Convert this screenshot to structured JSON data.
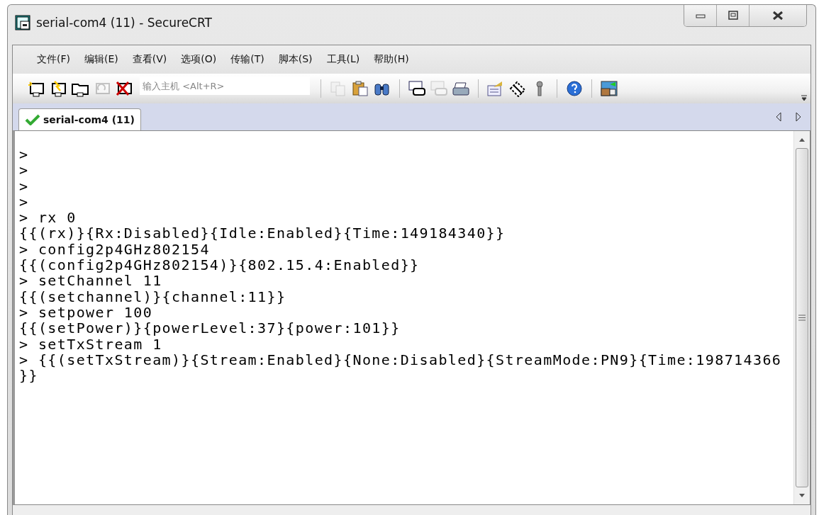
{
  "window": {
    "title": "serial-com4 (11) - SecureCRT"
  },
  "menu": [
    "文件(F)",
    "编辑(E)",
    "查看(V)",
    "选项(O)",
    "传输(T)",
    "脚本(S)",
    "工具(L)",
    "帮助(H)"
  ],
  "toolbar": [
    {
      "kind": "new-session",
      "disabled": false
    },
    {
      "kind": "quick-connect",
      "disabled": false
    },
    {
      "kind": "sessions",
      "disabled": false
    },
    {
      "kind": "reconnect",
      "disabled": true
    },
    {
      "kind": "disconnect",
      "disabled": false
    },
    {
      "kind": "host-field",
      "placeholder": "输入主机 <Alt+R>"
    },
    {
      "kind": "separator"
    },
    {
      "kind": "copy",
      "disabled": true
    },
    {
      "kind": "paste",
      "disabled": false
    },
    {
      "kind": "find",
      "disabled": false
    },
    {
      "kind": "separator"
    },
    {
      "kind": "print-screen",
      "disabled": false
    },
    {
      "kind": "print-selection",
      "disabled": true
    },
    {
      "kind": "print",
      "disabled": false
    },
    {
      "kind": "separator"
    },
    {
      "kind": "properties",
      "disabled": false
    },
    {
      "kind": "keymap",
      "disabled": false
    },
    {
      "kind": "key",
      "disabled": false
    },
    {
      "kind": "separator"
    },
    {
      "kind": "help",
      "disabled": false
    },
    {
      "kind": "separator"
    },
    {
      "kind": "sftp",
      "disabled": false
    }
  ],
  "tabs": [
    {
      "label": "serial-com4 (11)",
      "selected": true,
      "connected": true
    }
  ],
  "terminal": {
    "lines": [
      ">",
      ">",
      ">",
      ">",
      "> rx 0",
      "{{(rx)}{Rx:Disabled}{Idle:Enabled}{Time:149184340}}",
      "> config2p4GHz802154",
      "{{(config2p4GHz802154)}{802.15.4:Enabled}}",
      "> setChannel 11",
      "{{(setchannel)}{channel:11}}",
      "> setpower 100",
      "{{(setPower)}{powerLevel:37}{power:101}}",
      "> setTxStream 1",
      "> {{(setTxStream)}{Stream:Enabled}{None:Disabled}{StreamMode:PN9}{Time:198714366",
      "}}"
    ]
  }
}
